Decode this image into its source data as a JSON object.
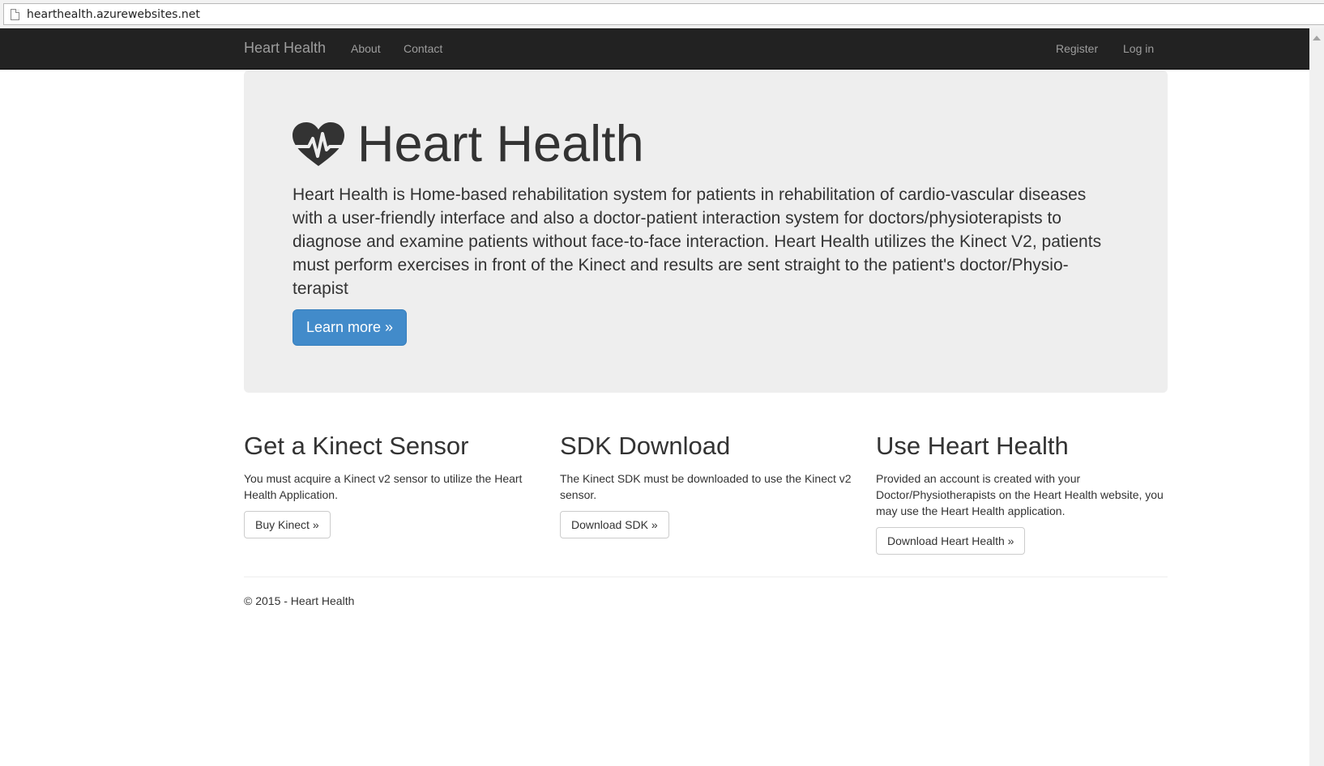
{
  "browser": {
    "url": "hearthealth.azurewebsites.net",
    "page_icon": "page-icon"
  },
  "navbar": {
    "brand": "Heart Health",
    "left_links": [
      "About",
      "Contact"
    ],
    "right_links": [
      "Register",
      "Log in"
    ]
  },
  "jumbotron": {
    "icon": "heart-pulse-icon",
    "title": "Heart Health",
    "lead": "Heart Health is Home-based rehabilitation system for patients in rehabilitation of cardio-vascular diseases with a user-friendly interface and also a doctor-patient interaction system for doctors/physioterapists to diagnose and examine patients without face-to-face interaction. Heart Health utilizes the Kinect V2, patients must perform exercises in front of the Kinect and results are sent straight to the patient's doctor/Physio-terapist",
    "button": "Learn more »"
  },
  "columns": [
    {
      "heading": "Get a Kinect Sensor",
      "text": "You must acquire a Kinect v2 sensor to utilize the Heart Health Application.",
      "button": "Buy Kinect »"
    },
    {
      "heading": "SDK Download",
      "text": "The Kinect SDK must be downloaded to use the Kinect v2 sensor.",
      "button": "Download SDK »"
    },
    {
      "heading": "Use Heart Health",
      "text": "Provided an account is created with your Doctor/Physiotherapists on the Heart Health website, you may use the Heart Health application.",
      "button": "Download Heart Health »"
    }
  ],
  "footer": {
    "text": "© 2015 - Heart Health"
  },
  "colors": {
    "navbar_bg": "#222222",
    "nav_text": "#9d9d9d",
    "jumbotron_bg": "#eeeeee",
    "primary": "#428bca",
    "text": "#333333"
  }
}
